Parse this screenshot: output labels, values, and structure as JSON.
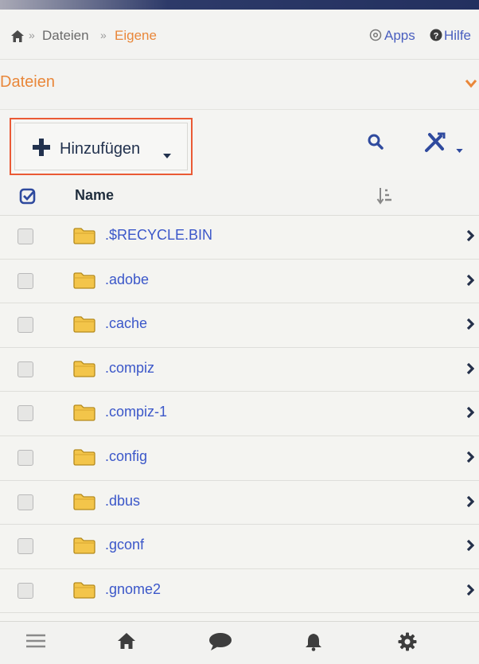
{
  "breadcrumb": {
    "items": [
      "Dateien",
      "Eigene"
    ],
    "separator": "»",
    "apps_label": "Apps",
    "help_label": "Hilfe"
  },
  "section": {
    "title": "Dateien"
  },
  "toolbar": {
    "add_label": "Hinzufügen",
    "highlight_color": "#ea5a35"
  },
  "list": {
    "header_name": "Name",
    "folders": [
      ".$RECYCLE.BIN",
      ".adobe",
      ".cache",
      ".compiz",
      ".compiz-1",
      ".config",
      ".dbus",
      ".gconf",
      ".gnome2"
    ]
  },
  "colors": {
    "accent_orange": "#e9873a",
    "link_blue": "#3b57c9",
    "nav_blue": "#2f4a9e",
    "folder_yellow": "#f3c54a"
  },
  "bottom_nav": [
    "menu-icon",
    "home-icon",
    "chat-icon",
    "bell-icon",
    "gear-icon"
  ]
}
